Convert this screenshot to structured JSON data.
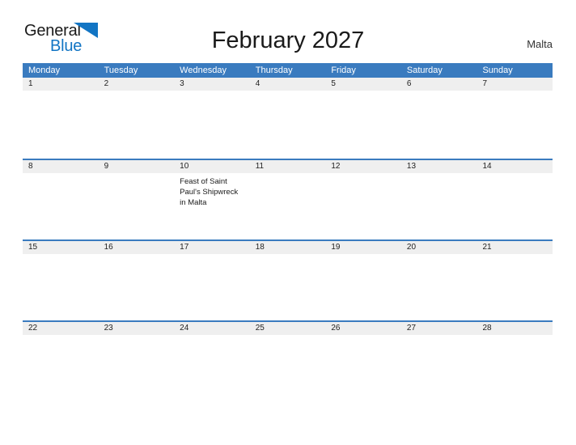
{
  "brand": {
    "name_top": "General",
    "name_bottom": "Blue",
    "flag_icon": "blue-triangle-flag-icon",
    "color_top": "#1a1a1a",
    "color_bottom": "#1275c4"
  },
  "header": {
    "title": "February 2027",
    "location": "Malta"
  },
  "theme": {
    "header_blue": "#3a7bbf",
    "date_band_gray": "#efefef",
    "separator_blue": "#3a7bbf",
    "text_dark": "#1a1a1a",
    "page_background": "#ffffff"
  },
  "calendar": {
    "month": "February",
    "year": "2027",
    "week_start": "Monday",
    "weekdays": [
      "Monday",
      "Tuesday",
      "Wednesday",
      "Thursday",
      "Friday",
      "Saturday",
      "Sunday"
    ],
    "weeks": [
      [
        {
          "date": "1",
          "events": []
        },
        {
          "date": "2",
          "events": []
        },
        {
          "date": "3",
          "events": []
        },
        {
          "date": "4",
          "events": []
        },
        {
          "date": "5",
          "events": []
        },
        {
          "date": "6",
          "events": []
        },
        {
          "date": "7",
          "events": []
        }
      ],
      [
        {
          "date": "8",
          "events": []
        },
        {
          "date": "9",
          "events": []
        },
        {
          "date": "10",
          "events": [
            "Feast of Saint Paul's Shipwreck in Malta"
          ]
        },
        {
          "date": "11",
          "events": []
        },
        {
          "date": "12",
          "events": []
        },
        {
          "date": "13",
          "events": []
        },
        {
          "date": "14",
          "events": []
        }
      ],
      [
        {
          "date": "15",
          "events": []
        },
        {
          "date": "16",
          "events": []
        },
        {
          "date": "17",
          "events": []
        },
        {
          "date": "18",
          "events": []
        },
        {
          "date": "19",
          "events": []
        },
        {
          "date": "20",
          "events": []
        },
        {
          "date": "21",
          "events": []
        }
      ],
      [
        {
          "date": "22",
          "events": []
        },
        {
          "date": "23",
          "events": []
        },
        {
          "date": "24",
          "events": []
        },
        {
          "date": "25",
          "events": []
        },
        {
          "date": "26",
          "events": []
        },
        {
          "date": "27",
          "events": []
        },
        {
          "date": "28",
          "events": []
        }
      ]
    ]
  }
}
